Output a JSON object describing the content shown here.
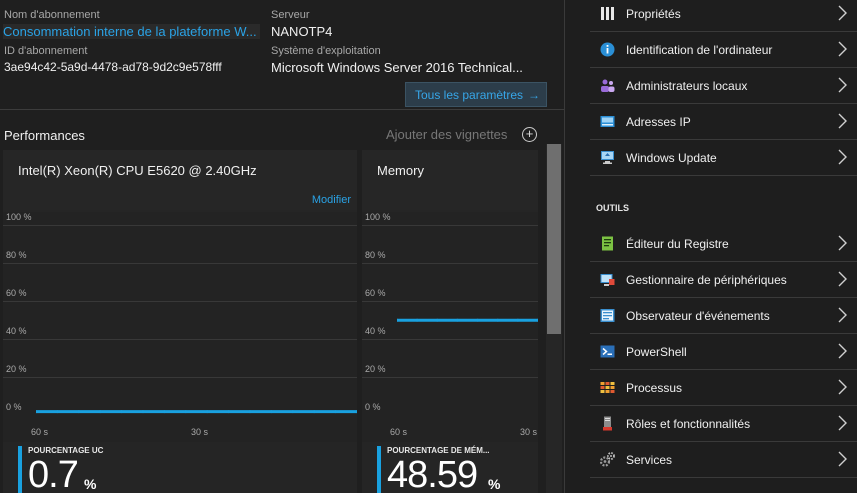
{
  "essentials": {
    "subscription_name_label": "Nom d'abonnement",
    "subscription_name_value": "Consommation interne de la plateforme W...",
    "subscription_id_label": "ID d'abonnement",
    "subscription_id_value": "3ae94c42-5a9d-4478-ad78-9d2c9e578fff",
    "server_label": "Serveur",
    "server_value": "NANOTP4",
    "os_label": "Système d'exploitation",
    "os_value": "Microsoft Windows Server 2016 Technical...",
    "all_settings_label": "Tous les paramètres",
    "all_settings_arrow": "→"
  },
  "performance": {
    "title": "Performances",
    "add_tiles_label": "Ajouter des vignettes",
    "add_tiles_icon": "+",
    "cpu_tile": {
      "title": "Intel(R) Xeon(R) CPU E5620 @ 2.40GHz",
      "edit_label": "Modifier",
      "y_ticks": [
        "100 %",
        "80 %",
        "60 %",
        "40 %",
        "20 %",
        "0 %"
      ],
      "x_ticks": [
        "60 s",
        "30 s"
      ],
      "metric_label": "POURCENTAGE UC",
      "metric_value": "0.7",
      "metric_unit": "%",
      "series_color": "#19a1e0",
      "series_percent": [
        0.7,
        0.7,
        0.7,
        0.7,
        0.7,
        0.7,
        0.7,
        0.7,
        0.7,
        0.7,
        0.7,
        0.7,
        0.7,
        0.7,
        0.7,
        0.7
      ]
    },
    "memory_tile": {
      "title": "Memory",
      "y_ticks": [
        "100 %",
        "80 %",
        "60 %",
        "40 %",
        "20 %",
        "0 %"
      ],
      "x_ticks": [
        "60 s",
        "30 s"
      ],
      "metric_label": "POURCENTAGE DE MÉM...",
      "metric_value": "48.59",
      "metric_unit": "%",
      "series_color": "#19a1e0",
      "series_percent": [
        48.59,
        48.59,
        48.59,
        48.59,
        48.59,
        48.59,
        48.59,
        48.59
      ]
    }
  },
  "settings_menu": {
    "items": [
      {
        "label": "Propriétés",
        "icon": "properties-icon"
      },
      {
        "label": "Identification de l'ordinateur",
        "icon": "info-icon"
      },
      {
        "label": "Administrateurs locaux",
        "icon": "users-icon"
      },
      {
        "label": "Adresses IP",
        "icon": "network-icon"
      },
      {
        "label": "Windows Update",
        "icon": "windows-update-icon"
      }
    ]
  },
  "tools_menu": {
    "section_title": "OUTILS",
    "items": [
      {
        "label": "Éditeur du Registre",
        "icon": "registry-icon"
      },
      {
        "label": "Gestionnaire de périphériques",
        "icon": "device-manager-icon"
      },
      {
        "label": "Observateur d'événements",
        "icon": "event-viewer-icon"
      },
      {
        "label": "PowerShell",
        "icon": "powershell-icon"
      },
      {
        "label": "Processus",
        "icon": "processes-icon"
      },
      {
        "label": "Rôles et fonctionnalités",
        "icon": "roles-icon"
      },
      {
        "label": "Services",
        "icon": "services-icon"
      }
    ]
  }
}
